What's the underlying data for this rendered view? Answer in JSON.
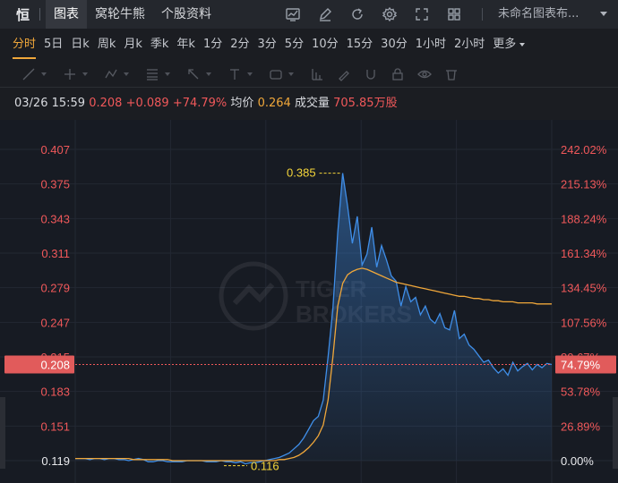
{
  "topbar": {
    "logo": "恒",
    "tabs": [
      "图表",
      "窝轮牛熊",
      "个股资料"
    ],
    "active_tab": 0,
    "tools": [
      "chart-indicator-icon",
      "pencil-icon",
      "refresh-icon",
      "gear-icon",
      "fullscreen-icon",
      "layout-grid-icon"
    ],
    "layout_name": "未命名图表布..."
  },
  "periods": {
    "items": [
      "分时",
      "5日",
      "日k",
      "周k",
      "月k",
      "季k",
      "年k",
      "1分",
      "2分",
      "3分",
      "5分",
      "10分",
      "15分",
      "30分",
      "1小时",
      "2小时",
      "更多"
    ],
    "active": "分时"
  },
  "drawing_tools": [
    "line-tool-icon",
    "cursor-tool-icon",
    "pattern-tool-icon",
    "fib-tool-icon",
    "arrow-tool-icon",
    "text-tool-icon",
    "shape-tool-icon",
    "measure-tool-icon",
    "brush-tool-icon",
    "magnet-icon",
    "lock-icon",
    "eye-icon",
    "trash-icon"
  ],
  "info": {
    "datetime": "03/26 15:59",
    "price": "0.208",
    "change": "+0.089",
    "change_pct": "+74.79%",
    "avg_label": "均价",
    "avg_value": "0.264",
    "volume_label": "成交量",
    "volume_value": "705.85万股"
  },
  "colors": {
    "up": "#f0585a",
    "avg_line": "#f0a73a",
    "price_line": "#3f8ee8",
    "highlight": "#f5d63a",
    "background": "#171b23"
  },
  "chart_data": {
    "type": "area",
    "y_price_ticks": [
      "0.407",
      "0.375",
      "0.343",
      "0.311",
      "0.279",
      "0.247",
      "0.215",
      "0.183",
      "0.151",
      "0.119"
    ],
    "y_pct_ticks": [
      "242.02%",
      "215.13%",
      "188.24%",
      "161.34%",
      "134.45%",
      "107.56%",
      "80.67%",
      "53.78%",
      "26.89%",
      "0.00%"
    ],
    "ylim": [
      0.119,
      0.407
    ],
    "prev_close": 0.119,
    "last_price_label": "0.208",
    "last_pct_label": "74.79%",
    "high_label": "0.385",
    "low_label": "0.116",
    "high": 0.385,
    "low": 0.116,
    "grid": true,
    "watermark_line1": "TIGER",
    "watermark_line2": "BROKERS",
    "series": [
      {
        "name": "price",
        "values": [
          0.121,
          0.121,
          0.121,
          0.12,
          0.121,
          0.121,
          0.12,
          0.121,
          0.121,
          0.12,
          0.12,
          0.119,
          0.12,
          0.121,
          0.12,
          0.118,
          0.118,
          0.119,
          0.119,
          0.118,
          0.118,
          0.118,
          0.118,
          0.119,
          0.119,
          0.119,
          0.119,
          0.118,
          0.118,
          0.118,
          0.119,
          0.118,
          0.118,
          0.117,
          0.118,
          0.116,
          0.117,
          0.117,
          0.118,
          0.119,
          0.12,
          0.121,
          0.122,
          0.124,
          0.126,
          0.13,
          0.134,
          0.14,
          0.148,
          0.156,
          0.16,
          0.175,
          0.215,
          0.26,
          0.33,
          0.385,
          0.355,
          0.32,
          0.345,
          0.3,
          0.31,
          0.335,
          0.298,
          0.318,
          0.305,
          0.29,
          0.285,
          0.262,
          0.28,
          0.266,
          0.27,
          0.254,
          0.262,
          0.25,
          0.246,
          0.255,
          0.242,
          0.24,
          0.258,
          0.232,
          0.236,
          0.226,
          0.222,
          0.216,
          0.21,
          0.212,
          0.205,
          0.2,
          0.204,
          0.198,
          0.21,
          0.202,
          0.206,
          0.209,
          0.203,
          0.208,
          0.205,
          0.209,
          0.208
        ]
      },
      {
        "name": "average",
        "values": [
          0.121,
          0.121,
          0.121,
          0.121,
          0.121,
          0.121,
          0.121,
          0.121,
          0.121,
          0.121,
          0.121,
          0.121,
          0.12,
          0.12,
          0.12,
          0.12,
          0.12,
          0.12,
          0.12,
          0.12,
          0.119,
          0.119,
          0.119,
          0.119,
          0.119,
          0.119,
          0.119,
          0.119,
          0.119,
          0.119,
          0.119,
          0.119,
          0.119,
          0.119,
          0.119,
          0.119,
          0.119,
          0.119,
          0.119,
          0.119,
          0.119,
          0.119,
          0.12,
          0.12,
          0.121,
          0.122,
          0.124,
          0.127,
          0.131,
          0.136,
          0.142,
          0.152,
          0.175,
          0.215,
          0.262,
          0.283,
          0.291,
          0.294,
          0.296,
          0.297,
          0.296,
          0.294,
          0.292,
          0.29,
          0.288,
          0.286,
          0.284,
          0.283,
          0.282,
          0.281,
          0.28,
          0.279,
          0.278,
          0.277,
          0.276,
          0.275,
          0.274,
          0.273,
          0.272,
          0.271,
          0.271,
          0.27,
          0.269,
          0.269,
          0.268,
          0.268,
          0.267,
          0.267,
          0.266,
          0.266,
          0.266,
          0.265,
          0.265,
          0.265,
          0.265,
          0.264,
          0.264,
          0.264,
          0.264
        ]
      }
    ]
  }
}
